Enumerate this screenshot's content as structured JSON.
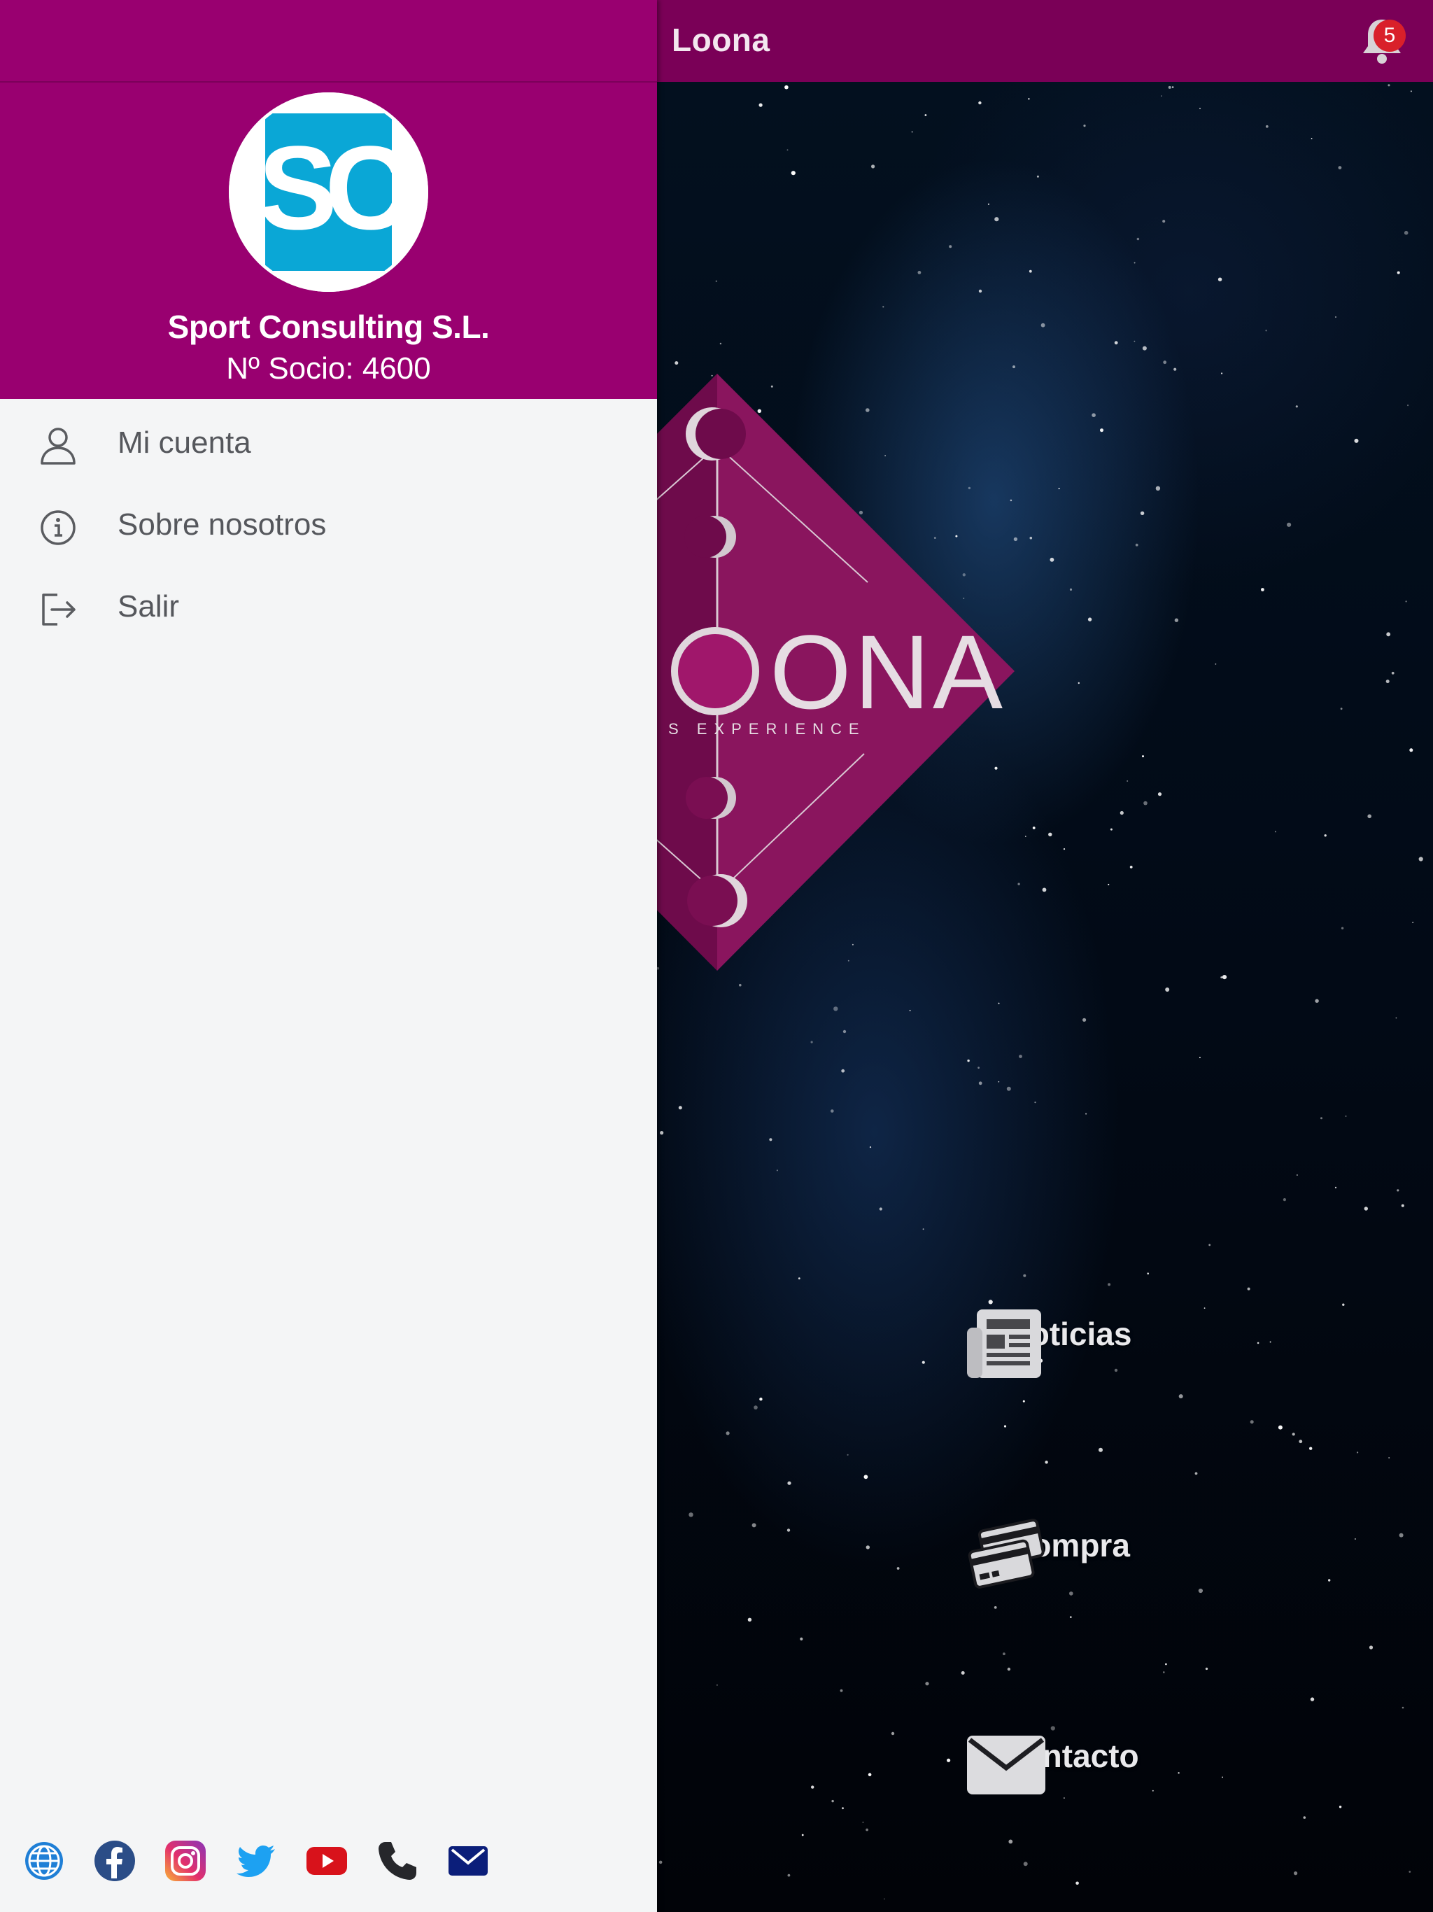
{
  "topbar": {
    "title": "Loona",
    "notification_count": "5"
  },
  "drawer": {
    "company_name": "Sport Consulting S.L.",
    "member_number": "Nº Socio: 4600",
    "avatar_text": "SC",
    "items": [
      {
        "label": "Mi cuenta",
        "icon": "user-icon"
      },
      {
        "label": "Sobre nosotros",
        "icon": "info-icon"
      },
      {
        "label": "Salir",
        "icon": "logout-icon"
      }
    ],
    "social": [
      "globe-icon",
      "facebook-icon",
      "instagram-icon",
      "twitter-icon",
      "youtube-icon",
      "phone-icon",
      "mail-icon"
    ]
  },
  "logo": {
    "text": "ONA",
    "tagline": "S      EXPERIENCE"
  },
  "menu": [
    {
      "label": "Noticias",
      "icon": "newspaper-icon"
    },
    {
      "label": "Compra",
      "icon": "credit-cards-icon"
    },
    {
      "label": "Contacto",
      "icon": "envelope-icon"
    }
  ],
  "colors": {
    "drawer_header": "#990070",
    "topbar": "#7a0057",
    "badge": "#d9202a",
    "drawer_bg": "#f4f5f6",
    "avatar_bg": "#0aa7d6"
  }
}
